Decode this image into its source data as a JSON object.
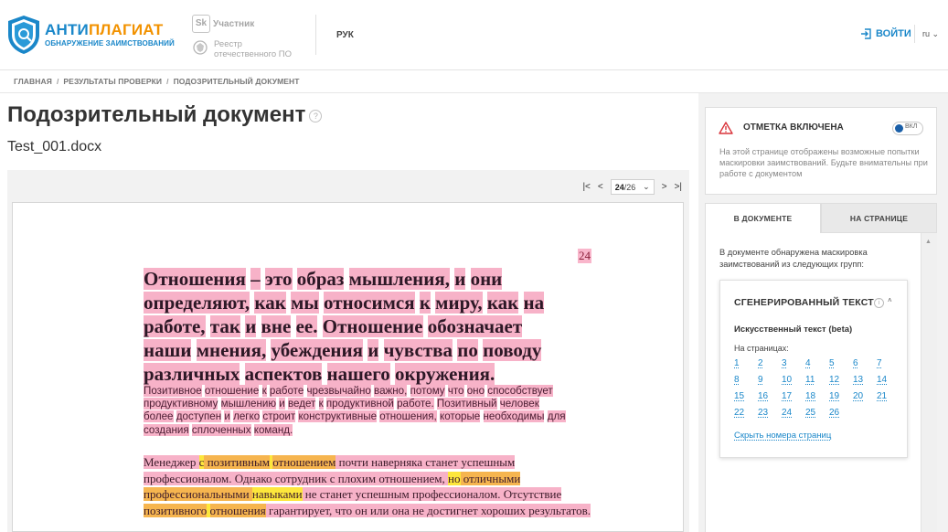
{
  "header": {
    "brand_part1": "АНТИ",
    "brand_part2": "ПЛАГИАТ",
    "brand_sub": "ОБНАРУЖЕНИЕ ЗАИМСТВОВАНИЙ",
    "sk_badge": "Sk",
    "sk_label": "Участник",
    "registry_label": "Реестр отечественного ПО",
    "role": "РУК",
    "login": "ВОЙТИ",
    "lang": "ru"
  },
  "breadcrumb": {
    "items": [
      "ГЛАВНАЯ",
      "РЕЗУЛЬТАТЫ ПРОВЕРКИ",
      "ПОДОЗРИТЕЛЬНЫЙ ДОКУМЕНТ"
    ],
    "separator": "/"
  },
  "main": {
    "title": "Подозрительный документ",
    "help": "?",
    "filename": "Test_001.docx"
  },
  "pager": {
    "current": "24",
    "total": "/26",
    "first": "|<",
    "prev": "<",
    "next": ">",
    "last": ">|"
  },
  "document": {
    "page_number": "24",
    "heading_words": [
      "Отношения",
      "–",
      "это",
      "образ",
      "мышления,",
      "и",
      "они",
      "определяют,",
      "как",
      "мы",
      "относимся",
      "к",
      "миру,",
      "как",
      "на",
      "работе,",
      "так",
      "и",
      "вне",
      "ее.",
      "Отношение",
      "обозначает",
      "наши",
      "мнения,",
      "убеждения",
      "и",
      "чувства",
      "по",
      "поводу",
      "различных",
      "аспектов",
      "нашего",
      "окружения."
    ],
    "para1_words": [
      "Позитивное",
      "отношение",
      "к",
      "работе",
      "чрезвычайно",
      "важно,",
      "потому",
      "что",
      "оно",
      "способствует",
      "продуктивному",
      "мышлению",
      "и",
      "ведет",
      "к",
      "продуктивной",
      "работе.",
      "Позитивный",
      "человек",
      "более",
      "доступен",
      "и",
      "легко",
      "строит",
      "конструктивные",
      "отношения,",
      "которые",
      "необходимы",
      "для",
      "создания",
      "сплоченных",
      "команд."
    ],
    "para2_segments": [
      {
        "t": " Менеджер ",
        "h": "p"
      },
      {
        "t": "с",
        "h": "y"
      },
      {
        "t": " ",
        "h": "o"
      },
      {
        "t": "позитивным",
        "h": "o"
      },
      {
        "t": " ",
        "h": "y"
      },
      {
        "t": "отношением",
        "h": "o"
      },
      {
        "t": " почти наверняка станет успешным профессионалом. Однако сотрудник с плохим отношением, ",
        "h": "p"
      },
      {
        "t": "но",
        "h": "y"
      },
      {
        "t": " отличными профессиональными ",
        "h": "o"
      },
      {
        "t": "навыками",
        "h": "y"
      },
      {
        "t": " не станет успешным профессионалом. Отсутствие ",
        "h": "p"
      },
      {
        "t": "позитивного",
        "h": "o"
      },
      {
        "t": " ",
        "h": "y"
      },
      {
        "t": "отношения",
        "h": "o"
      },
      {
        "t": " гарантирует, что он или она не достигнет хороших результатов.",
        "h": "p"
      }
    ]
  },
  "panel": {
    "alert_title": "ОТМЕТКА ВКЛЮЧЕНА",
    "toggle_label": "ВКЛ",
    "alert_text": "На этой странице отображены возможные попытки маскировки заимствований. Будьте внимательны при работе с документом",
    "tab_document": "В ДОКУМЕНТЕ",
    "tab_page": "НА СТРАНИЦЕ",
    "intro": "В документе обнаружена маскировка заимствований из следующих групп:",
    "group_title": "СГЕНЕРИРОВАННЫЙ ТЕКСТ",
    "group_sub": "Искусственный текст (beta)",
    "pages_label": "На страницах:",
    "pages": [
      "1",
      "2",
      "3",
      "4",
      "5",
      "6",
      "7",
      "8",
      "9",
      "10",
      "11",
      "12",
      "13",
      "14",
      "15",
      "16",
      "17",
      "18",
      "19",
      "20",
      "21",
      "22",
      "23",
      "24",
      "25",
      "26"
    ],
    "hide_link": "Скрыть номера страниц"
  },
  "colors": {
    "brand_blue": "#1a87c9",
    "brand_orange": "#f29200",
    "hl_pink": "#f7b2c8",
    "hl_orange": "#f6b54f",
    "hl_yellow": "#fde73c"
  }
}
